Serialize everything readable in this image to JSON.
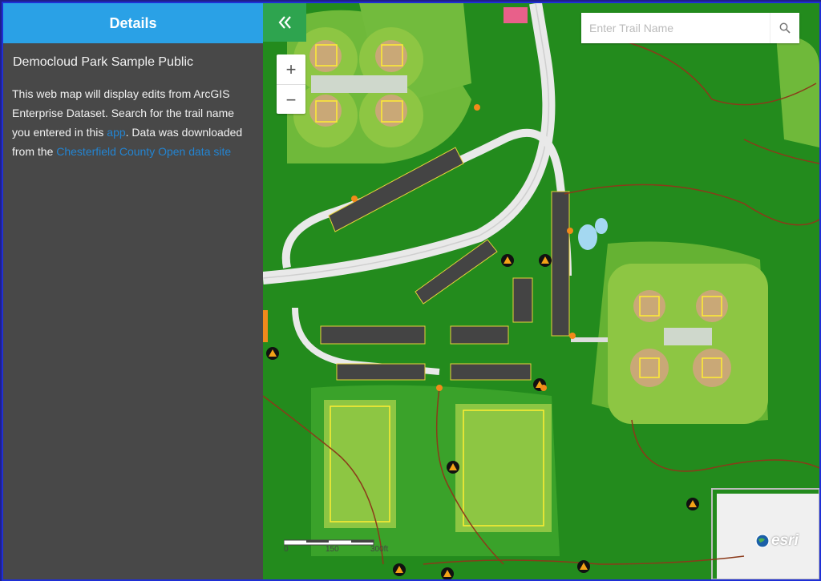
{
  "sidebar": {
    "header": "Details",
    "title": "Democloud Park Sample Public",
    "desc_part1": "This web map will display edits from ArcGIS Enterprise Dataset. Search for the trail name you entered in this ",
    "desc_link1": "app",
    "desc_part2": ". Data was downloaded from the ",
    "desc_link2": "Chesterfield County Open data site",
    "desc_part3": ""
  },
  "map": {
    "collapse_icon": "double-chevron-left-icon",
    "zoom_in": "+",
    "zoom_out": "−",
    "search_placeholder": "Enter Trail Name",
    "scale": {
      "label0": "0",
      "label1": "150",
      "label2": "300ft"
    },
    "attribution": "esri"
  },
  "colors": {
    "header": "#2aa1e6",
    "collapse": "#2ea44f",
    "grass": "#238b1d",
    "field": "#8cc63f",
    "road": "#eeeeee"
  }
}
